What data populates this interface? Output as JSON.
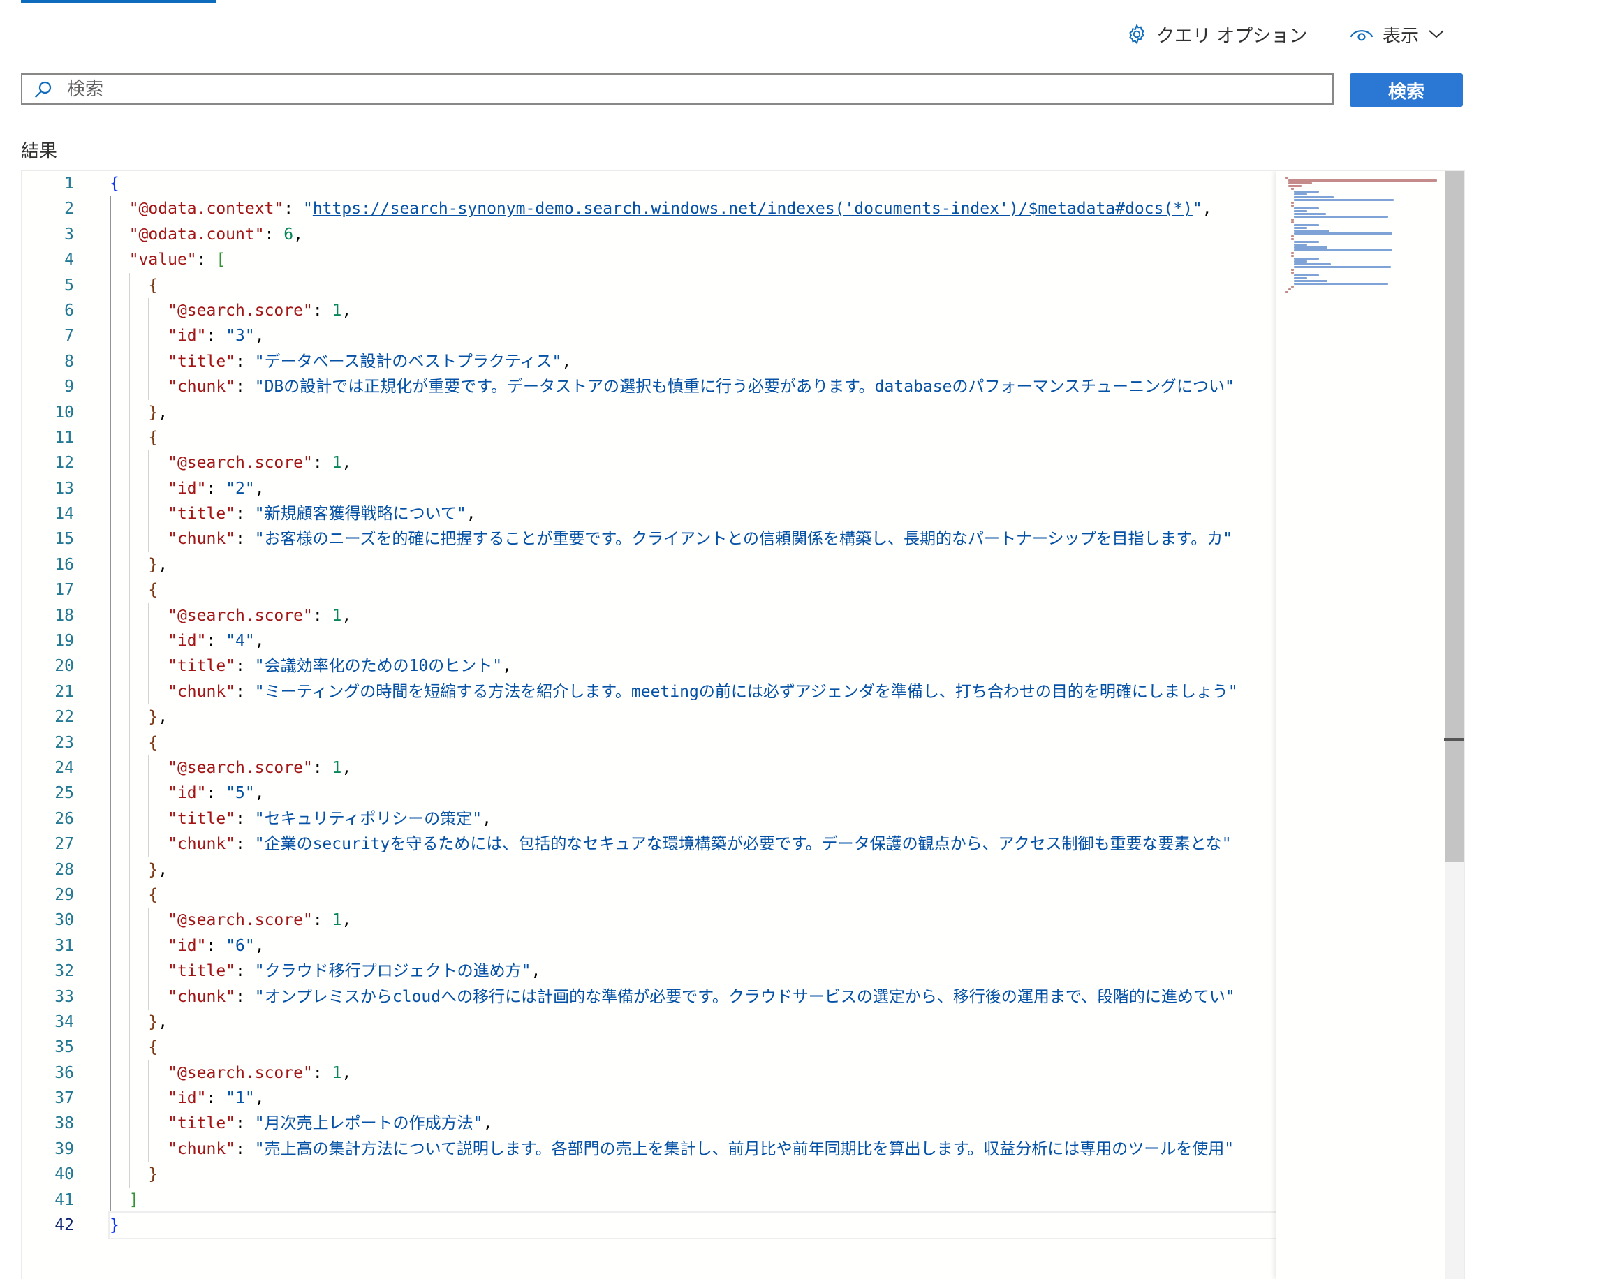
{
  "toolbar": {
    "query_options_label": "クエリ オプション",
    "view_label": "表示",
    "query_icon": "gear-icon",
    "view_icon": "eye-icon"
  },
  "search": {
    "placeholder": "検索",
    "value": "",
    "button_label": "検索",
    "icon": "search-icon"
  },
  "results_label": "結果",
  "colors": {
    "accent": "#2b78d4",
    "json_key": "#a31515",
    "json_string": "#0451a5",
    "json_number": "#098658",
    "line_number": "#237893"
  },
  "editor": {
    "active_line": 42,
    "line_numbers": [
      "1",
      "2",
      "3",
      "4",
      "5",
      "6",
      "7",
      "8",
      "9",
      "10",
      "11",
      "12",
      "13",
      "14",
      "15",
      "16",
      "17",
      "18",
      "19",
      "20",
      "21",
      "22",
      "23",
      "24",
      "25",
      "26",
      "27",
      "28",
      "29",
      "30",
      "31",
      "32",
      "33",
      "34",
      "35",
      "36",
      "37",
      "38",
      "39",
      "40",
      "41",
      "42"
    ],
    "response": {
      "odata_context": "https://search-synonym-demo.search.windows.net/indexes('documents-index')/$metadata#docs(*)",
      "odata_count": 6,
      "value": [
        {
          "score": 1,
          "id": "3",
          "title": "データベース設計のベストプラクティス",
          "chunk": "DBの設計では正規化が重要です。データストアの選択も慎重に行う必要があります。databaseのパフォーマンスチューニングについ"
        },
        {
          "score": 1,
          "id": "2",
          "title": "新規顧客獲得戦略について",
          "chunk": "お客様のニーズを的確に把握することが重要です。クライアントとの信頼関係を構築し、長期的なパートナーシップを目指します。カ"
        },
        {
          "score": 1,
          "id": "4",
          "title": "会議効率化のための10のヒント",
          "chunk": "ミーティングの時間を短縮する方法を紹介します。meetingの前には必ずアジェンダを準備し、打ち合わせの目的を明確にしましょう"
        },
        {
          "score": 1,
          "id": "5",
          "title": "セキュリティポリシーの策定",
          "chunk": "企業のsecurityを守るためには、包括的なセキュアな環境構築が必要です。データ保護の観点から、アクセス制御も重要な要素とな"
        },
        {
          "score": 1,
          "id": "6",
          "title": "クラウド移行プロジェクトの進め方",
          "chunk": "オンプレミスからcloudへの移行には計画的な準備が必要です。クラウドサービスの選定から、移行後の運用まで、段階的に進めてい"
        },
        {
          "score": 1,
          "id": "1",
          "title": "月次売上レポートの作成方法",
          "chunk": "売上高の集計方法について説明します。各部門の売上を集計し、前月比や前年同期比を算出します。収益分析には専用のツールを使用"
        }
      ]
    }
  }
}
